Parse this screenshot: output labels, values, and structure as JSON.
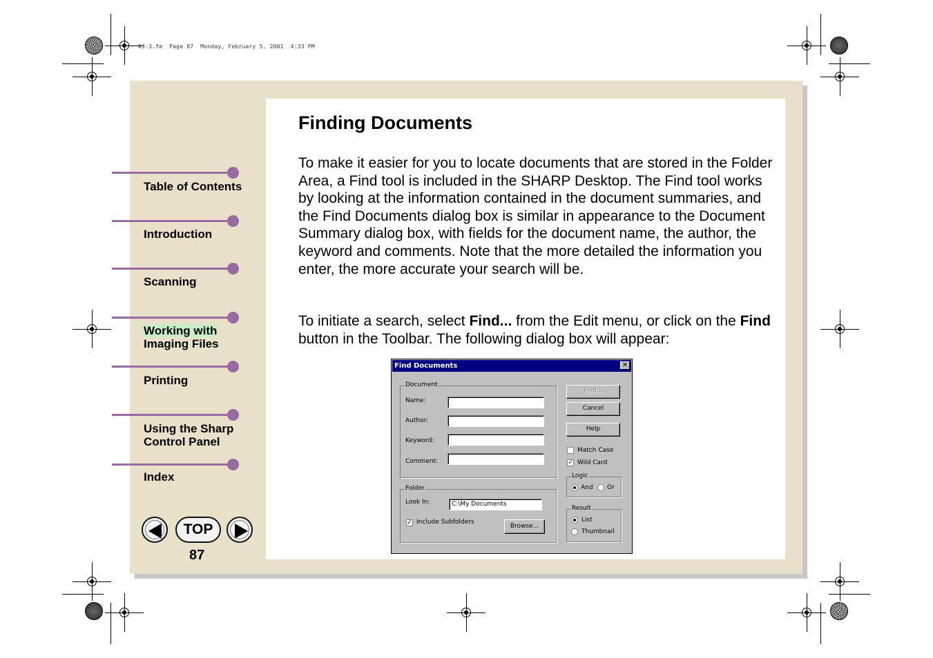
{
  "header": {
    "file_info": "03-3.fm  Page 87  Monday, February 5, 2001  4:33 PM"
  },
  "main": {
    "title": "Finding Documents",
    "para1": "To make it easier for you to locate documents that are stored in the Folder Area, a Find tool is included in the SHARP Desktop. The Find tool works by looking at the information contained in the document summaries, and the Find Documents dialog box is similar in appearance to the Document Summary dialog box, with fields for the document name, the author, the keyword and comments. Note that the more detailed the information you enter, the more accurate your search will be.",
    "para2_a": "To initiate a search, select ",
    "para2_find_menu": "Find...",
    "para2_b": " from the Edit menu, or click on the ",
    "para2_find_btn": "Find",
    "para2_c": " button in the Toolbar. The following dialog box will appear:"
  },
  "nav": {
    "items": [
      {
        "label": "Table of Contents"
      },
      {
        "label": "Introduction"
      },
      {
        "label": "Scanning"
      },
      {
        "label_line1": "Working with",
        "label_line2": "Imaging Files"
      },
      {
        "label": "Printing"
      },
      {
        "label_line1": "Using the Sharp",
        "label_line2": "Control Panel"
      },
      {
        "label": "Index"
      }
    ],
    "top_label": "TOP",
    "page_number": "87",
    "prev_icon": "arrow-left-icon",
    "next_icon": "arrow-right-icon"
  },
  "dialog": {
    "title": "Find Documents",
    "close": "✕",
    "document_group": "Document",
    "name_label": "Name:",
    "author_label": "Author:",
    "keyword_label": "Keyword:",
    "comment_label": "Comment:",
    "name_value": "",
    "author_value": "",
    "keyword_value": "",
    "comment_value": "",
    "folder_group": "Folder",
    "lookin_label": "Look In:",
    "lookin_value": "C:\\My Documents",
    "include_subfolders": "Include Subfolders",
    "include_subfolders_checked": true,
    "browse": "Browse...",
    "find": "Find...",
    "cancel": "Cancel",
    "help": "Help",
    "match_case": "Match Case",
    "match_case_checked": false,
    "wild_card": "Wild Card",
    "wild_card_checked": true,
    "logic_group": "Logic",
    "logic_and": "And",
    "logic_or": "Or",
    "logic_selected": "And",
    "result_group": "Result",
    "result_list": "List",
    "result_thumbnail": "Thumbnail",
    "result_selected": "List",
    "check_mark": "✓"
  },
  "colors": {
    "frame": "#e8e0c8",
    "nav_accent": "#9a6aa3",
    "dialog_title": "#000080",
    "highlight": "#c8eec8"
  }
}
